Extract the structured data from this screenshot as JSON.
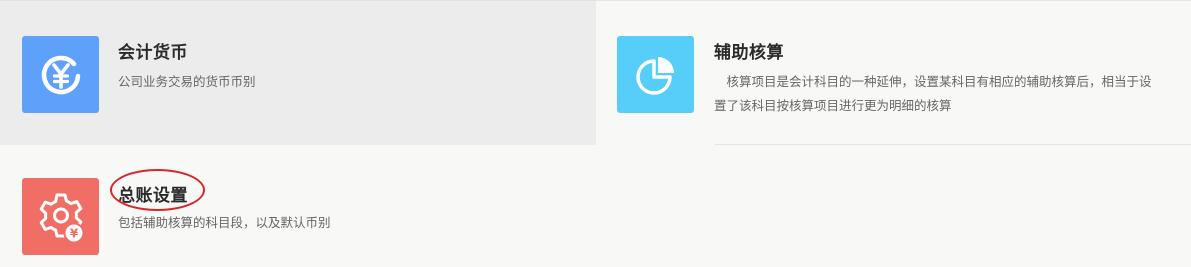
{
  "cards": [
    {
      "title": "会计货币",
      "description": "公司业务交易的货币币别",
      "icon": "yen-circle-icon",
      "icon_color": "#5ea1fb"
    },
    {
      "title": "辅助核算",
      "description": "　核算项目是会计科目的一种延伸，设置某科目有相应的辅助核算后，相当于设置了该科目按核算项目进行更为明细的核算",
      "icon": "pie-chart-icon",
      "icon_color": "#57cdfa"
    },
    {
      "title": "总账设置",
      "description": "包括辅助核算的科目段，以及默认币别",
      "icon": "gear-yen-icon",
      "icon_color": "#f06e66"
    }
  ],
  "annotation": {
    "type": "red-circle",
    "target": "总账设置",
    "color": "#d9252a"
  }
}
